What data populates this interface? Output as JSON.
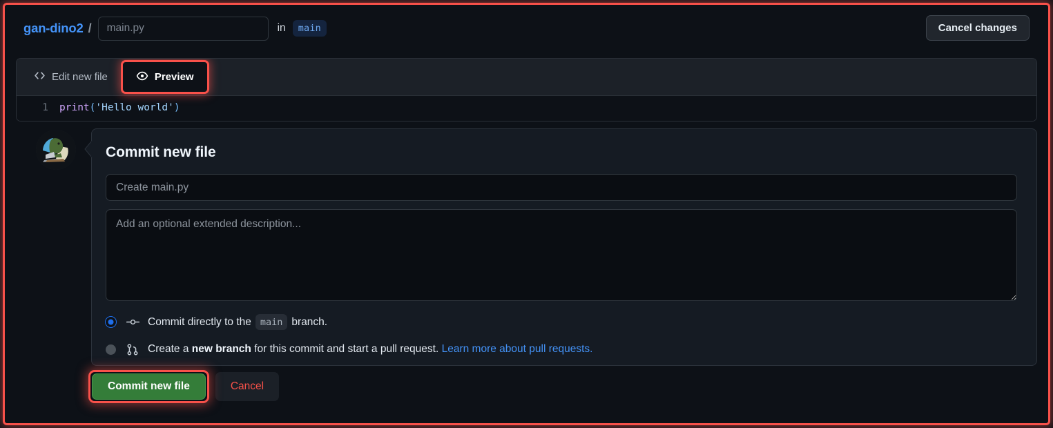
{
  "header": {
    "repo_name": "gan-dino2",
    "path_separator": "/",
    "filename_placeholder": "main.py",
    "filename_value": "",
    "in_label": "in",
    "branch_badge": "main",
    "cancel_changes_label": "Cancel changes"
  },
  "editor": {
    "tabs": [
      {
        "label": "Edit new file",
        "icon": "code-icon",
        "active": false
      },
      {
        "label": "Preview",
        "icon": "eye-icon",
        "active": true
      }
    ],
    "line_number": "1",
    "code": {
      "function": "print",
      "open_paren": "(",
      "string": "'Hello world'",
      "close_paren": ")"
    }
  },
  "commit_form": {
    "title": "Commit new file",
    "summary_placeholder": "Create main.py",
    "summary_value": "",
    "description_placeholder": "Add an optional extended description...",
    "description_value": "",
    "options": [
      {
        "selected": true,
        "icon": "git-commit-icon",
        "text_before": "Commit directly to the",
        "branch": "main",
        "text_after": "branch."
      },
      {
        "selected": false,
        "icon": "git-branch-icon",
        "text_before": "Create a",
        "bold": "new branch",
        "text_after": "for this commit and start a pull request.",
        "link": "Learn more about pull requests."
      }
    ],
    "commit_button_label": "Commit new file",
    "cancel_button_label": "Cancel"
  },
  "avatar": {
    "name": "user-avatar-dino"
  },
  "colors": {
    "page_bg": "#0d1117",
    "panel_bg": "#151b23",
    "accent_link": "#4493f8",
    "commit_green": "#347d39",
    "danger_red": "#f85149",
    "highlight_red": "#f8514a",
    "radio_blue": "#1f6feb"
  }
}
